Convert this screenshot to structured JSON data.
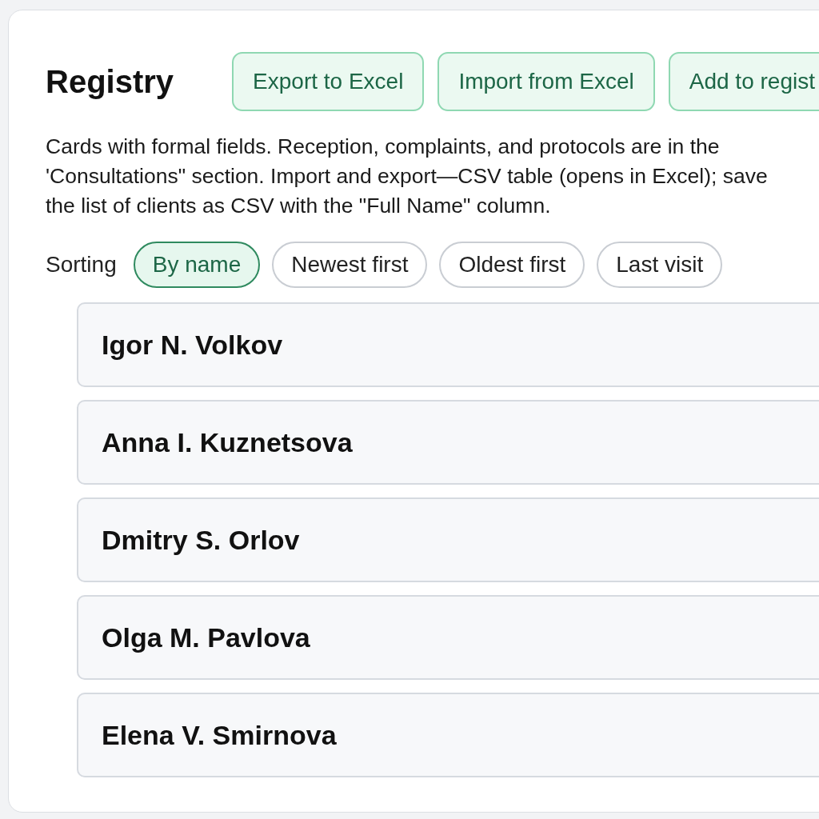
{
  "title": "Registry",
  "actions": [
    "Export to Excel",
    "Import from Excel",
    "Add to regist"
  ],
  "description": "Cards with formal fields. Reception, complaints, and protocols are in the 'Consultations\" section. Import and export—CSV table (opens in Excel); save the list of clients as CSV with the \"Full Name\" column.",
  "sorting": {
    "label": "Sorting",
    "options": [
      {
        "label": "By name",
        "selected": true
      },
      {
        "label": "Newest first",
        "selected": false
      },
      {
        "label": "Oldest first",
        "selected": false
      },
      {
        "label": "Last visit",
        "selected": false
      }
    ]
  },
  "clients": [
    {
      "name": "Igor N. Volkov"
    },
    {
      "name": "Anna I. Kuznetsova"
    },
    {
      "name": "Dmitry S. Orlov"
    },
    {
      "name": "Olga M. Pavlova"
    },
    {
      "name": "Elena V. Smirnova"
    }
  ]
}
